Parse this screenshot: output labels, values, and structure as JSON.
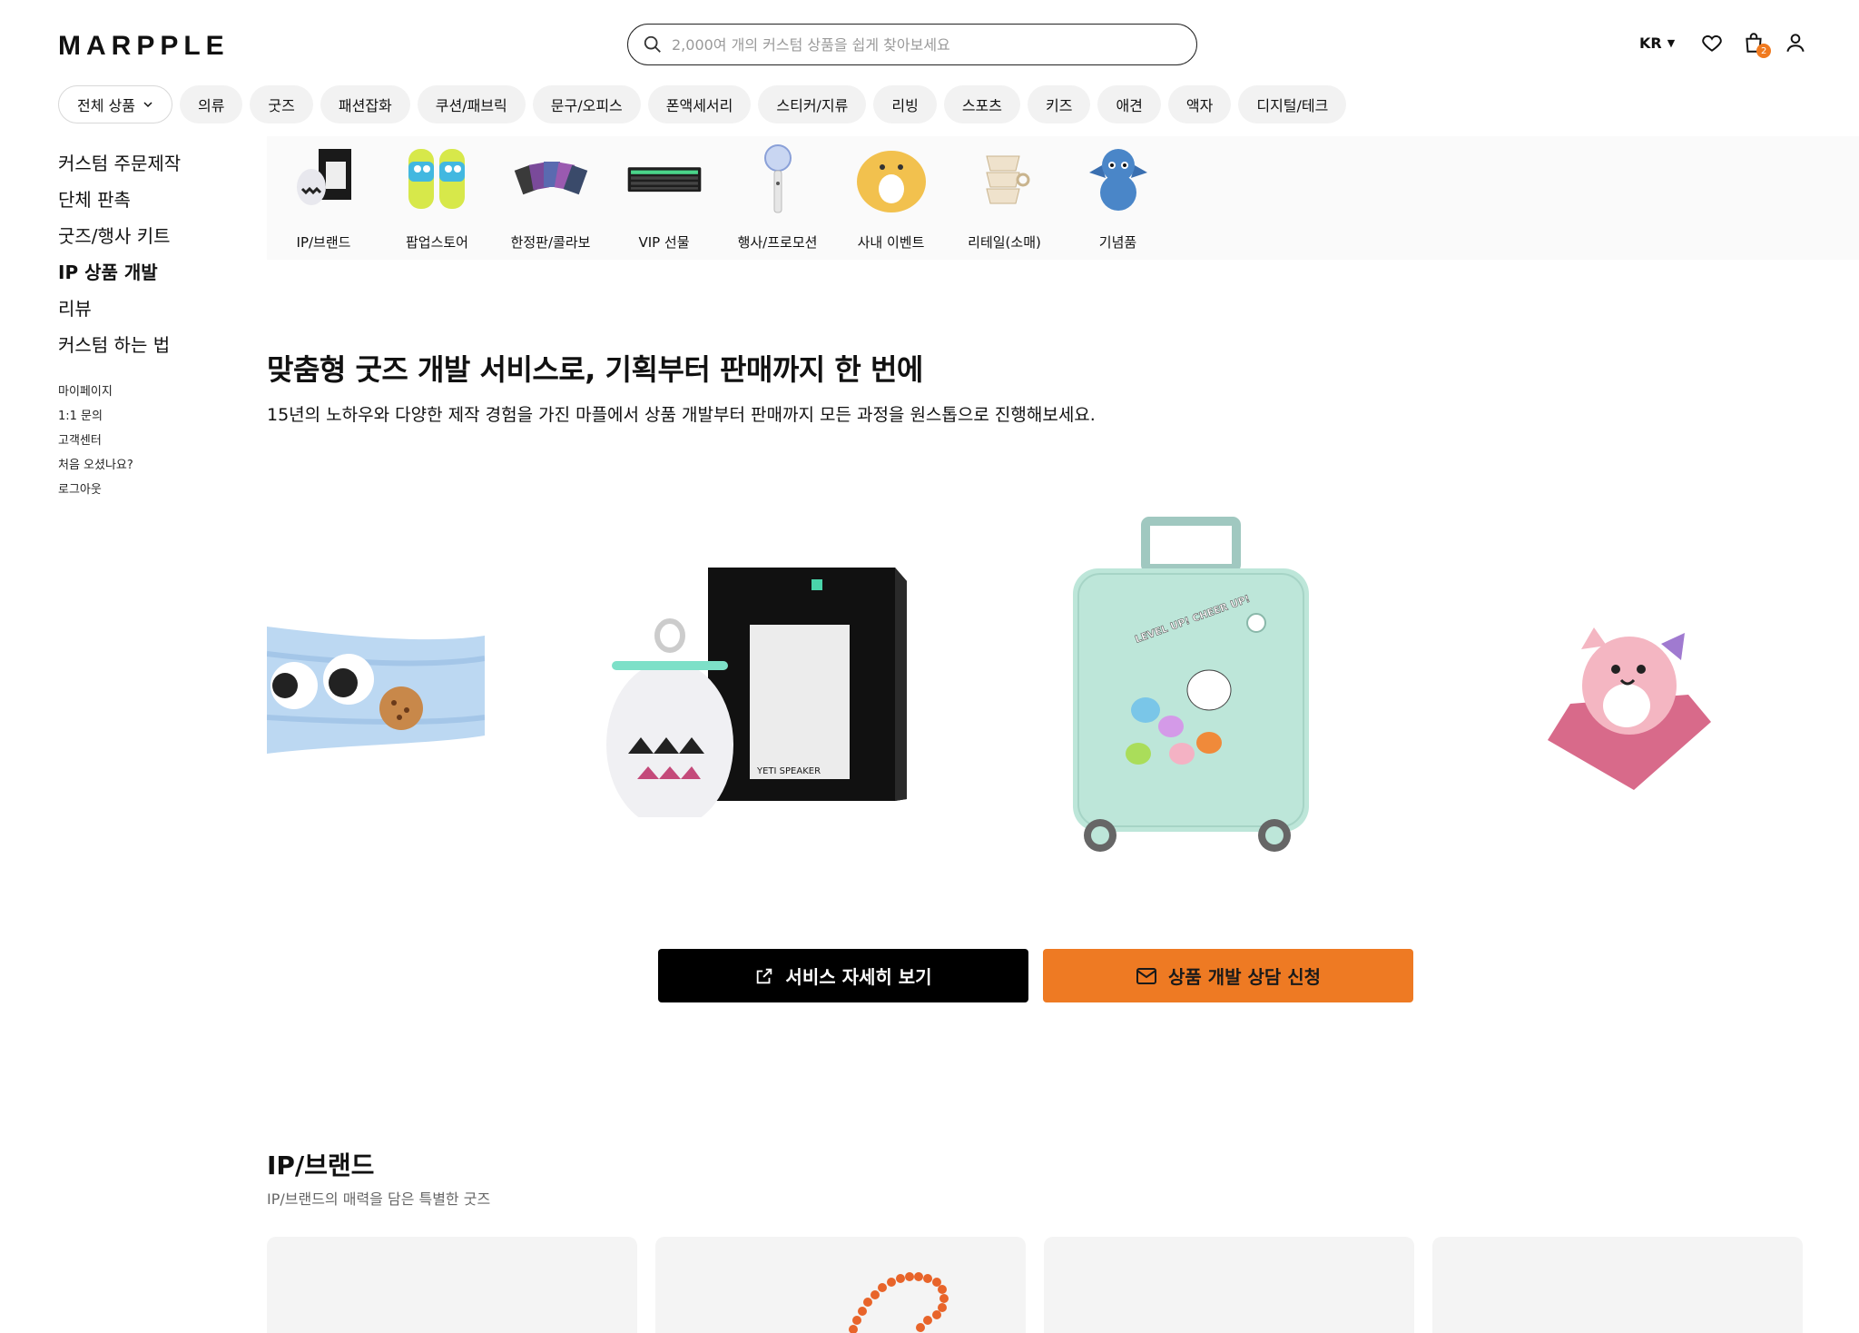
{
  "header": {
    "logo": "MARPPLE",
    "search_placeholder": "2,000여 개의 커스텀 상품을 쉽게 찾아보세요",
    "lang": "KR",
    "cart_count": "2"
  },
  "categories": [
    "전체 상품",
    "의류",
    "굿즈",
    "패션잡화",
    "쿠션/패브릭",
    "문구/오피스",
    "폰액세서리",
    "스티커/지류",
    "리빙",
    "스포츠",
    "키즈",
    "애견",
    "액자",
    "디지털/테크"
  ],
  "sidebar": {
    "main": [
      "커스텀 주문제작",
      "단체 판촉",
      "굿즈/행사 키트",
      "IP 상품 개발",
      "리뷰",
      "커스텀 하는 법"
    ],
    "sub": [
      "마이페이지",
      "1:1 문의",
      "고객센터",
      "처음 오셨나요?",
      "로그아웃"
    ]
  },
  "strip": [
    "IP/브랜드",
    "팝업스토어",
    "한정판/콜라보",
    "VIP 선물",
    "행사/프로모션",
    "사내 이벤트",
    "리테일(소매)",
    "기념품"
  ],
  "hero": {
    "title": "맞춤형 굿즈 개발 서비스로, 기획부터 판매까지 한 번에",
    "subtitle": "15년의 노하우와 다양한 제작 경험을 가진 마플에서 상품 개발부터 판매까지 모든 과정을 원스톱으로 진행해보세요.",
    "speaker_text": "YETI SPEAKER",
    "suitcase_text": "LEVEL UP! CHEER UP!",
    "btn_detail": "서비스 자세히 보기",
    "btn_consult": "상품 개발 상담 신청"
  },
  "section": {
    "title": "IP/브랜드",
    "subtitle": "IP/브랜드의 매력을 담은 특별한 굿즈"
  },
  "colors": {
    "accent": "#ee7a23",
    "chip_bg": "#f2f2f2",
    "black": "#000000"
  }
}
